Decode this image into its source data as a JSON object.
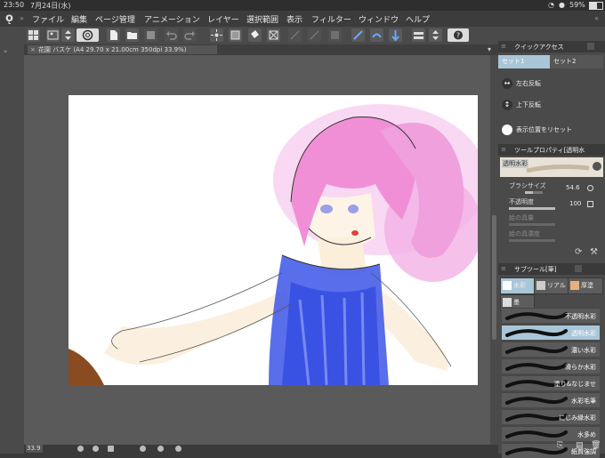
{
  "status": {
    "time": "23:50",
    "date": "7月24日(水)",
    "battery": "59%"
  },
  "menu": [
    "ファイル",
    "編集",
    "ページ管理",
    "アニメーション",
    "レイヤー",
    "選択範囲",
    "表示",
    "フィルター",
    "ウィンドウ",
    "ヘルプ"
  ],
  "document": {
    "tab_title": "花園 バスケ (A4 29.70 x 21.00cm 350dpi 33.9%)",
    "close_glyph": "×"
  },
  "bottom": {
    "zoom": "33.9"
  },
  "quick_access": {
    "title": "クイックアクセス",
    "tabs": [
      "セット1",
      "セット2"
    ],
    "items": [
      "左右反転",
      "上下反転",
      "表示位置をリセット"
    ]
  },
  "tool_property": {
    "title": "ツールプロパティ[透明水",
    "brush_name": "透明水彩",
    "brush_size_label": "ブラシサイズ",
    "brush_size_value": "54.6",
    "opacity_label": "不透明度",
    "opacity_value": "100",
    "opacity_level": 1.0,
    "brush_size_level": 0.45,
    "paint_density_label": "絵の具量",
    "paint_thickness_label": "絵の具濃度"
  },
  "subtool": {
    "title": "サブツール[筆]",
    "tabs": [
      "水彩",
      "リアル",
      "厚塗",
      "墨"
    ],
    "brushes": [
      "不透明水彩",
      "透明水彩",
      "濃い水彩",
      "滑らか水彩",
      "塗り&なじませ",
      "水彩毛筆",
      "にじみ縁水彩",
      "水多め",
      "紙質強調"
    ],
    "selected": "透明水彩"
  },
  "colors": {
    "accent": "#a9c6d8",
    "hair": "#f0a0d8",
    "dress": "#3050e0",
    "skin": "#fbeedb"
  }
}
